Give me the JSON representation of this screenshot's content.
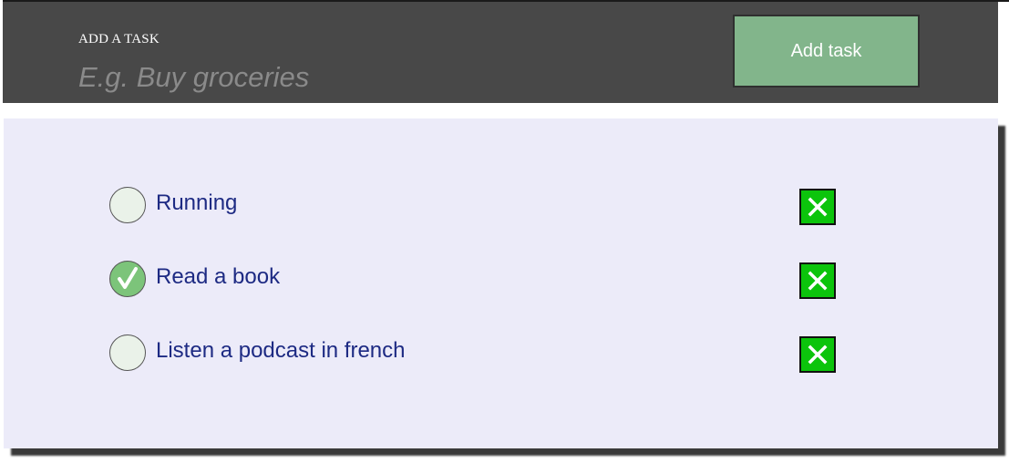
{
  "header": {
    "label": "ADD A TASK",
    "input_placeholder": "E.g. Buy groceries",
    "input_value": "",
    "add_button_label": "Add task"
  },
  "tasks": [
    {
      "text": "Running",
      "completed": false
    },
    {
      "text": "Read a book",
      "completed": true
    },
    {
      "text": "Listen a podcast in french",
      "completed": false
    }
  ],
  "icons": {
    "check": "checkmark-icon",
    "delete": "close-icon"
  },
  "colors": {
    "header_bg": "#484848",
    "add_button_bg": "#82b58b",
    "panel_bg": "#ecebf9",
    "task_text": "#1d2a83",
    "checkbox_unchecked": "#eaf2e9",
    "checkbox_checked": "#7cc47a",
    "delete_button_bg": "#0cc40c"
  }
}
